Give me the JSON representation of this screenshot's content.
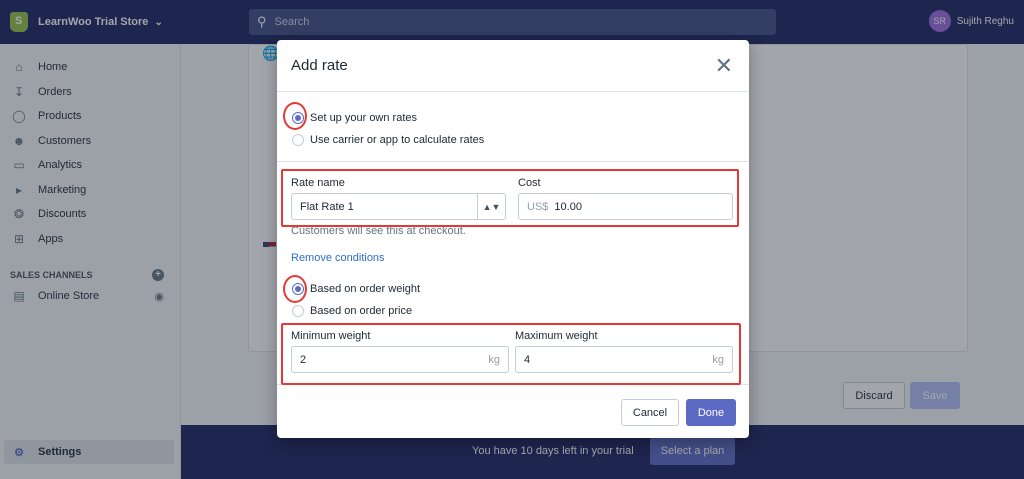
{
  "topbar": {
    "store_name": "LearnWoo Trial Store",
    "search_placeholder": "Search",
    "user_initials": "SR",
    "user_name": "Sujith Reghu"
  },
  "sidebar": {
    "items": [
      {
        "label": "Home",
        "icon": "home-icon"
      },
      {
        "label": "Orders",
        "icon": "orders-icon"
      },
      {
        "label": "Products",
        "icon": "tag-icon"
      },
      {
        "label": "Customers",
        "icon": "user-icon"
      },
      {
        "label": "Analytics",
        "icon": "chart-icon"
      },
      {
        "label": "Marketing",
        "icon": "megaphone-icon"
      },
      {
        "label": "Discounts",
        "icon": "discount-icon"
      },
      {
        "label": "Apps",
        "icon": "apps-icon"
      }
    ],
    "sales_channels_label": "SALES CHANNELS",
    "online_store_label": "Online Store",
    "settings_label": "Settings"
  },
  "page": {
    "discard_label": "Discard",
    "save_label": "Save",
    "trial_text": "You have 10 days left in your trial",
    "select_plan_label": "Select a plan"
  },
  "modal": {
    "title": "Add rate",
    "rate_options": [
      {
        "label": "Set up your own rates",
        "selected": true
      },
      {
        "label": "Use carrier or app to calculate rates",
        "selected": false
      }
    ],
    "rate_name_label": "Rate name",
    "rate_name_value": "Flat Rate 1",
    "cost_label": "Cost",
    "cost_prefix": "US$",
    "cost_value": "10.00",
    "help_text": "Customers will see this at checkout.",
    "remove_conditions_label": "Remove conditions",
    "condition_options": [
      {
        "label": "Based on order weight",
        "selected": true
      },
      {
        "label": "Based on order price",
        "selected": false
      }
    ],
    "min_weight_label": "Minimum weight",
    "min_weight_value": "2",
    "max_weight_label": "Maximum weight",
    "max_weight_value": "4",
    "weight_unit": "kg",
    "cancel_label": "Cancel",
    "done_label": "Done"
  },
  "colors": {
    "topbar": "#1c2260",
    "primary": "#5c6ac4",
    "annotation": "#e53935"
  }
}
